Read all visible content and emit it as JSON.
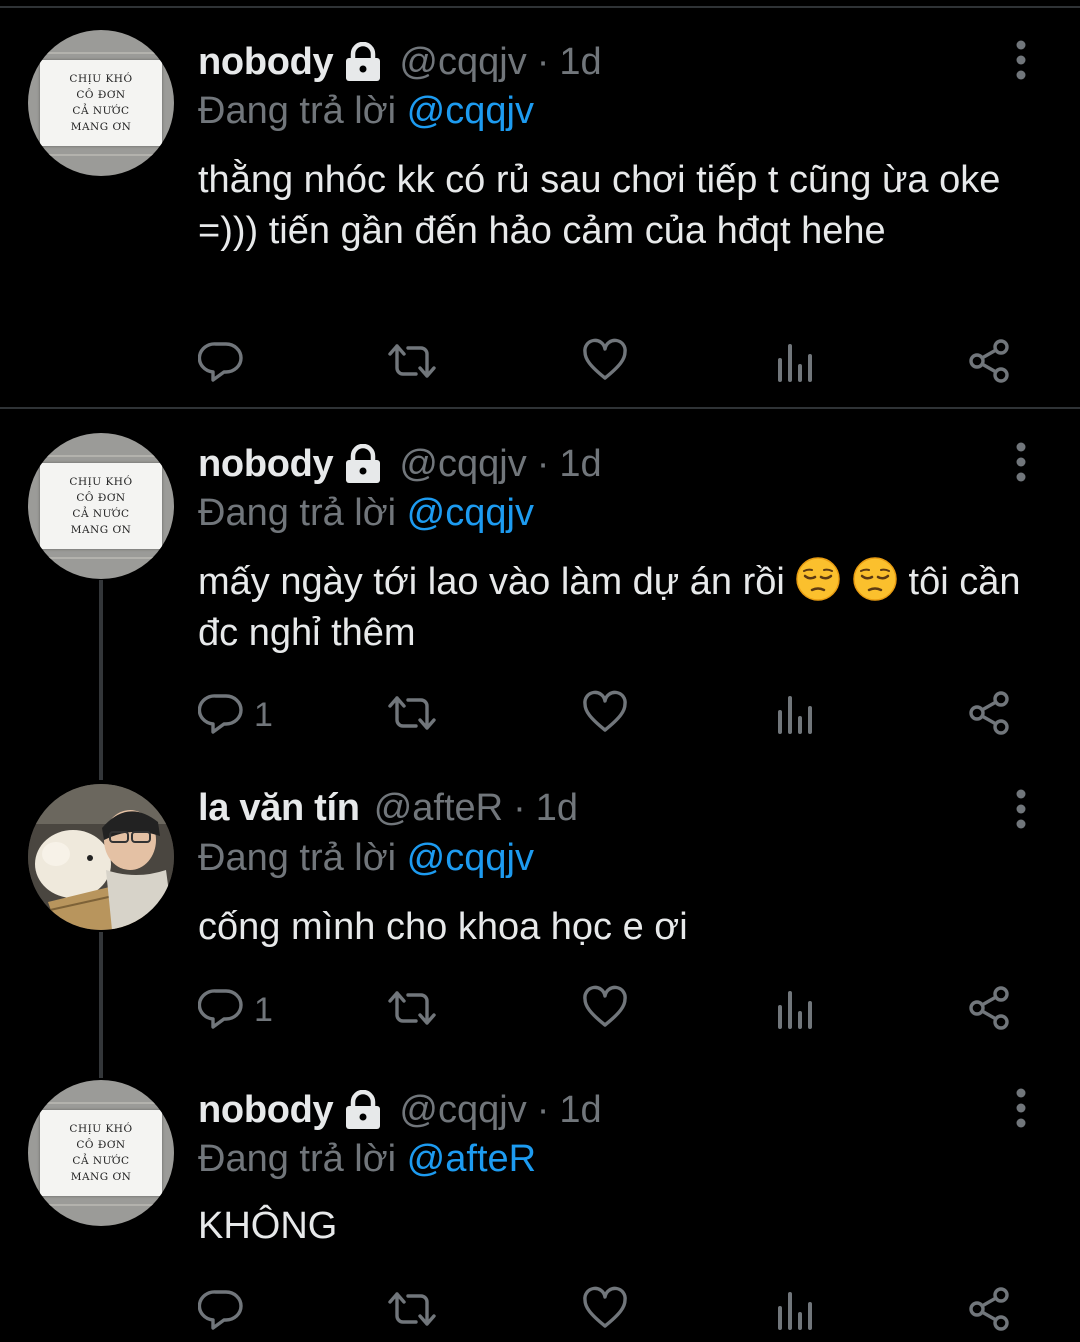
{
  "tweets": [
    {
      "name": "nobody",
      "handle": "@cqqjv",
      "dot": "·",
      "time": "1d",
      "reply_prefix": "Đang trả lời",
      "reply_mention": "@cqqjv",
      "content": "thằng nhóc kk có rủ sau chơi tiếp t cũng ừa oke =))) tiến gần đến hảo cảm của hđqt hehe",
      "protected": true,
      "avatar": "sign",
      "reply_count": ""
    },
    {
      "name": "nobody",
      "handle": "@cqqjv",
      "dot": "·",
      "time": "1d",
      "reply_prefix": "Đang trả lời",
      "reply_mention": "@cqqjv",
      "content_before": "mấy ngày tới lao vào làm dự án rồi",
      "emoji": "pensive-face",
      "content_after": "tôi cần đc nghỉ thêm",
      "protected": true,
      "avatar": "sign",
      "reply_count": "1"
    },
    {
      "name": "la văn tín",
      "handle": "@afteR",
      "dot": "·",
      "time": "1d",
      "reply_prefix": "Đang trả lời",
      "reply_mention": "@cqqjv",
      "content": "cống mình cho khoa học e ơi",
      "protected": false,
      "avatar": "photo",
      "reply_count": "1"
    },
    {
      "name": "nobody",
      "handle": "@cqqjv",
      "dot": "·",
      "time": "1d",
      "reply_prefix": "Đang trả lời",
      "reply_mention": "@afteR",
      "content": "KHÔNG",
      "protected": true,
      "avatar": "sign",
      "reply_count": ""
    }
  ],
  "avatar_sign_lines": [
    "CHỊU KHÓ",
    "CÔ ĐƠN",
    "CẢ NƯỚC",
    "MANG ƠN"
  ],
  "icons": [
    "reply-icon",
    "retweet-icon",
    "like-icon",
    "views-icon",
    "share-icon",
    "lock-icon",
    "more-icon"
  ],
  "colors": {
    "background": "#000000",
    "text": "#e7e9ea",
    "muted": "#71767b",
    "mention": "#1d9bf0",
    "divider": "#2f3336"
  }
}
